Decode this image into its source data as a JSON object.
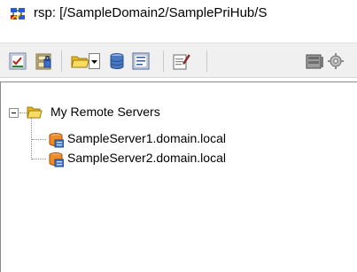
{
  "window": {
    "title": "rsp: [/SampleDomain2/SamplePriHub/S",
    "app_icon": "network-app-icon"
  },
  "toolbar": {
    "buttons": [
      {
        "name": "checklist-icon"
      },
      {
        "name": "security-cabinet-icon"
      },
      {
        "name": "open-folder-icon"
      },
      {
        "name": "dropdown-arrow-icon"
      },
      {
        "name": "database-icon"
      },
      {
        "name": "properties-icon"
      },
      {
        "name": "edit-note-icon"
      },
      {
        "name": "server-icon"
      },
      {
        "name": "gear-icon"
      }
    ]
  },
  "tree": {
    "root": {
      "label": "My Remote Servers",
      "icon": "open-folder-icon",
      "expanded": true,
      "children": [
        {
          "label": "SampleServer1.domain.local",
          "icon": "server-db-icon"
        },
        {
          "label": "SampleServer2.domain.local",
          "icon": "server-db-icon"
        }
      ]
    }
  },
  "colors": {
    "toolbar_bg": "#f0f0f0",
    "folder_yellow": "#f4d33c",
    "server_orange": "#f08a24",
    "server_blue": "#3a78c9"
  }
}
